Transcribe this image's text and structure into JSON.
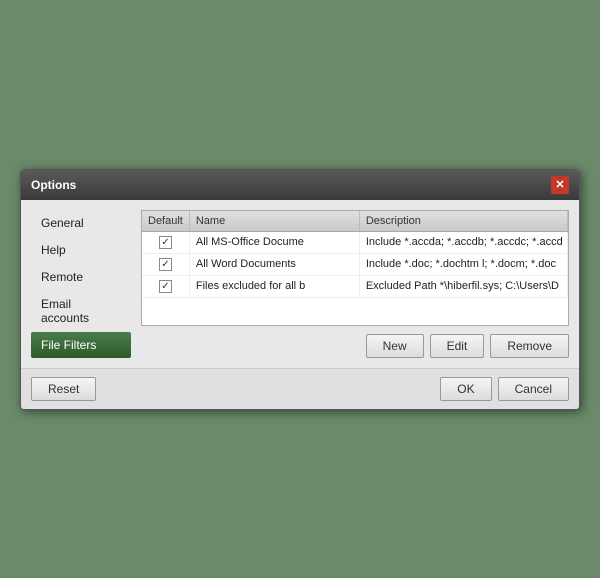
{
  "dialog": {
    "title": "Options",
    "close_icon": "✕"
  },
  "sidebar": {
    "items": [
      {
        "id": "general",
        "label": "General",
        "active": false
      },
      {
        "id": "help",
        "label": "Help",
        "active": false
      },
      {
        "id": "remote",
        "label": "Remote",
        "active": false
      },
      {
        "id": "email_accounts",
        "label": "Email accounts",
        "active": false
      },
      {
        "id": "file_filters",
        "label": "File Filters",
        "active": true
      }
    ]
  },
  "table": {
    "columns": [
      {
        "id": "default",
        "label": "Default"
      },
      {
        "id": "name",
        "label": "Name"
      },
      {
        "id": "description",
        "label": "Description"
      }
    ],
    "rows": [
      {
        "checked": true,
        "name": "All MS-Office Docume",
        "description": "Include *.accda; *.accdb; *.accdc; *.accd"
      },
      {
        "checked": true,
        "name": "All Word Documents",
        "description": "Include *.doc; *.dochtm l; *.docm; *.doc"
      },
      {
        "checked": true,
        "name": "Files excluded for all b",
        "description": "Excluded Path *\\hiberfil.sys; C:\\Users\\D"
      }
    ]
  },
  "buttons": {
    "new": "New",
    "edit": "Edit",
    "remove": "Remove",
    "reset": "Reset",
    "ok": "OK",
    "cancel": "Cancel"
  }
}
